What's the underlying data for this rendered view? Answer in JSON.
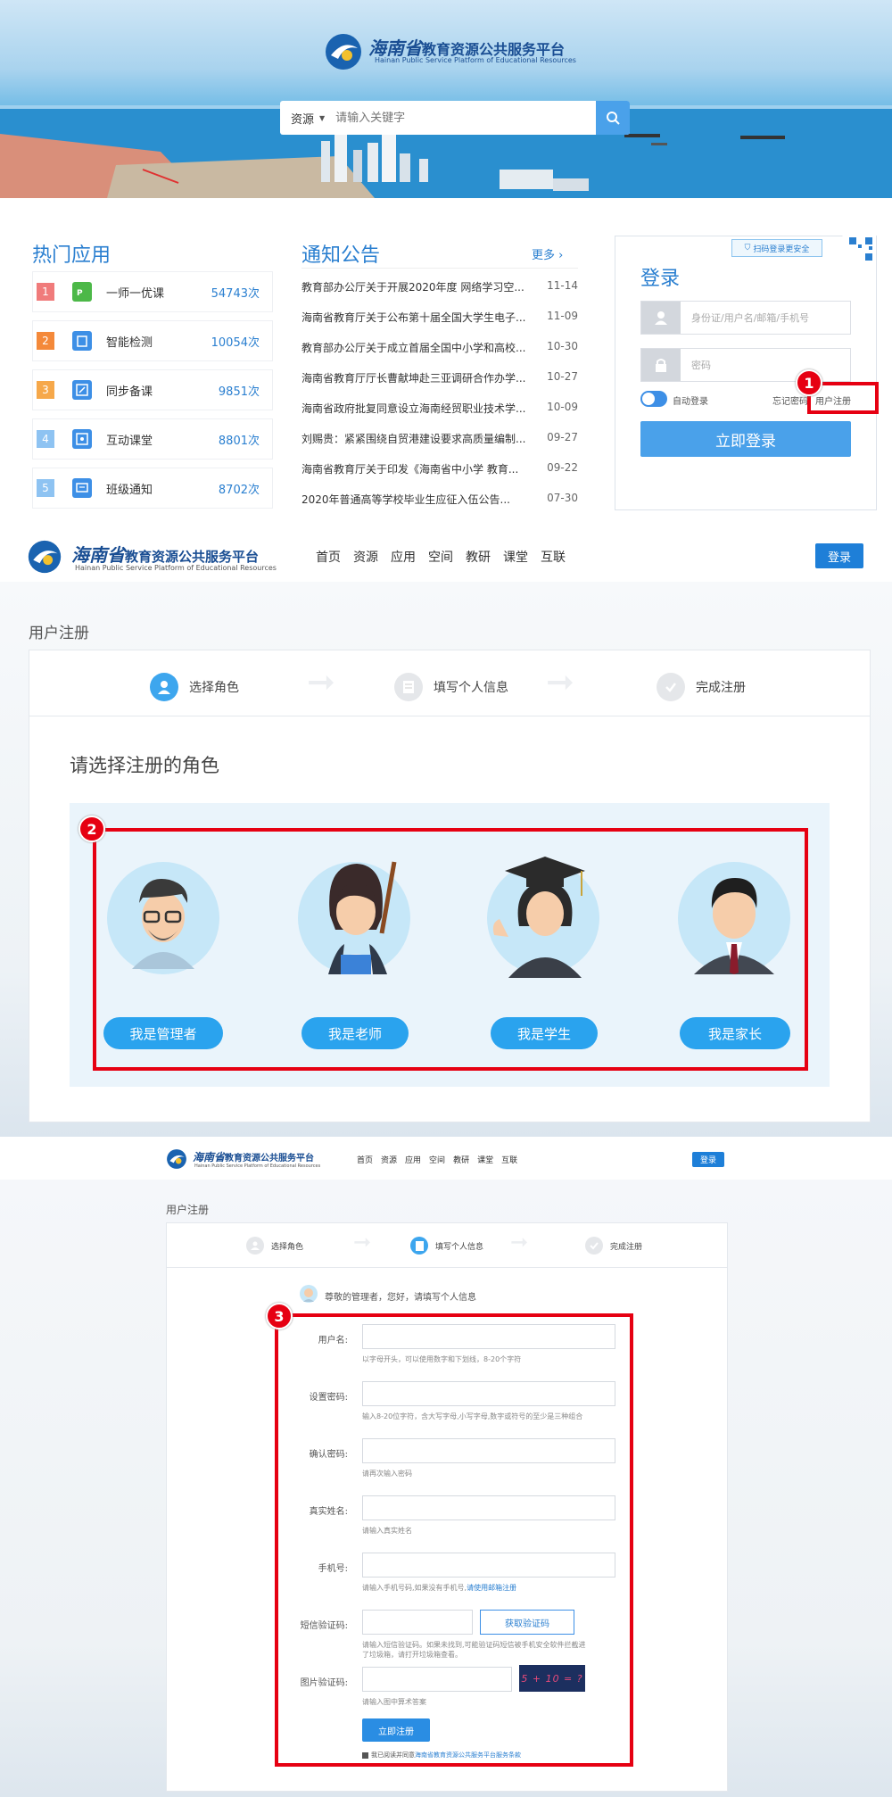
{
  "header": {
    "brand_cn_a": "海南省",
    "brand_cn_b": "教育资源公共服务平台",
    "brand_en": "Hainan Public Service Platform of Educational Resources"
  },
  "search": {
    "category": "资源",
    "placeholder": "请输入关键字"
  },
  "hot_apps": {
    "title": "热门应用",
    "items": [
      {
        "rank": "1",
        "name": "一师一优课",
        "count": "54743次",
        "color": "#f07b7b",
        "icon_color": "#4cb848",
        "icon": "ppt-icon"
      },
      {
        "rank": "2",
        "name": "智能检测",
        "count": "10054次",
        "color": "#f4893a",
        "icon_color": "#3d8fe6",
        "icon": "clipboard-icon"
      },
      {
        "rank": "3",
        "name": "同步备课",
        "count": "9851次",
        "color": "#f6a84a",
        "icon_color": "#3d8fe6",
        "icon": "edit-icon"
      },
      {
        "rank": "4",
        "name": "互动课堂",
        "count": "8801次",
        "color": "#8ec3f2",
        "icon_color": "#3d8fe6",
        "icon": "classroom-icon"
      },
      {
        "rank": "5",
        "name": "班级通知",
        "count": "8702次",
        "color": "#8ec3f2",
        "icon_color": "#3d8fe6",
        "icon": "message-icon"
      }
    ]
  },
  "notices": {
    "title": "通知公告",
    "more": "更多 ›",
    "items": [
      {
        "title": "教育部办公厅关于开展2020年度 网络学习空...",
        "date": "11-14"
      },
      {
        "title": "海南省教育厅关于公布第十届全国大学生电子...",
        "date": "11-09"
      },
      {
        "title": "教育部办公厅关于成立首届全国中小学和高校...",
        "date": "10-30"
      },
      {
        "title": "海南省教育厅厅长曹献坤赴三亚调研合作办学...",
        "date": "10-27"
      },
      {
        "title": "海南省政府批复同意设立海南经贸职业技术学...",
        "date": "10-09"
      },
      {
        "title": "刘赐贵：紧紧围绕自贸港建设要求高质量编制...",
        "date": "09-27"
      },
      {
        "title": "海南省教育厅关于印发《海南省中小学 教育...",
        "date": "09-22"
      },
      {
        "title": "2020年普通高等学校毕业生应征入伍公告...",
        "date": "07-30"
      }
    ]
  },
  "login": {
    "title": "登录",
    "qr_tip": "扫码登录更安全",
    "username_placeholder": "身份证/用户名/邮箱/手机号",
    "password_placeholder": "密码",
    "auto_login": "自动登录",
    "forgot": "忘记密码",
    "register": "用户注册",
    "submit": "立即登录"
  },
  "nav": {
    "items": [
      "首页",
      "资源",
      "应用",
      "空间",
      "教研",
      "课堂",
      "互联"
    ],
    "login": "登录"
  },
  "register": {
    "page_title": "用户注册",
    "steps": [
      "选择角色",
      "填写个人信息",
      "完成注册"
    ],
    "choose_title": "请选择注册的角色",
    "roles": [
      "我是管理者",
      "我是老师",
      "我是学生",
      "我是家长"
    ]
  },
  "form": {
    "greeting": "尊敬的管理者，您好，请填写个人信息",
    "fields": [
      {
        "label": "用户名:",
        "hint": "以字母开头，可以使用数字和下划线，8-20个字符"
      },
      {
        "label": "设置密码:",
        "hint": "输入8-20位字符，含大写字母,小写字母,数字或符号的至少是三种组合"
      },
      {
        "label": "确认密码:",
        "hint": "请再次输入密码"
      },
      {
        "label": "真实姓名:",
        "hint": "请输入真实姓名"
      },
      {
        "label": "手机号:",
        "hint": "请输入手机号码,如果没有手机号,",
        "hint_link": "请使用邮箱注册"
      }
    ],
    "sms_label": "短信验证码:",
    "sms_button": "获取验证码",
    "sms_hint_1": "请输入短信验证码。如果未找到,可能验证码短信被手机安全软件拦截进",
    "sms_hint_2": "了垃圾箱，请打开垃圾箱查看。",
    "captcha_label": "图片验证码:",
    "captcha_hint": "请输入图中算术答案",
    "captcha_text": "5 + 10 = ?",
    "submit": "立即注册",
    "agree": "我已阅读并同意",
    "agree_link": "海南省教育资源公共服务平台服务条款"
  },
  "annotations": [
    "1",
    "2",
    "3"
  ],
  "colors": {
    "accent": "#2a7fd0",
    "button": "#4aa1ea",
    "highlight": "#e60012"
  }
}
